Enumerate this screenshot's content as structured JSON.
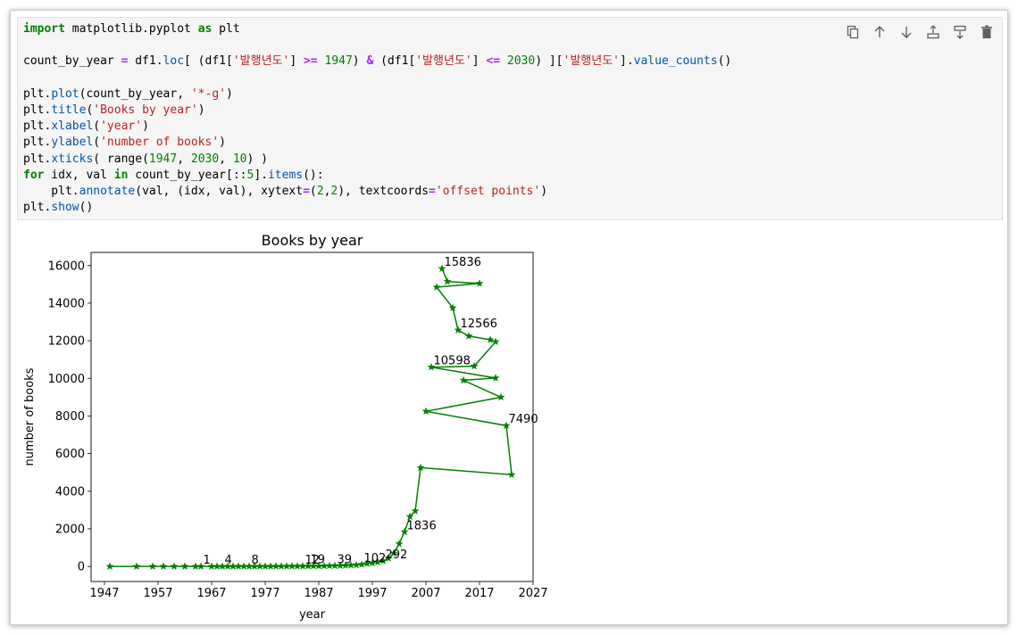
{
  "toolbar": {
    "buttons": [
      {
        "name": "copy-cell-button",
        "icon": "copy-icon"
      },
      {
        "name": "move-up-button",
        "icon": "arrow-up-icon"
      },
      {
        "name": "move-down-button",
        "icon": "arrow-down-icon"
      },
      {
        "name": "insert-above-button",
        "icon": "insert-above-icon"
      },
      {
        "name": "insert-below-button",
        "icon": "insert-below-icon"
      },
      {
        "name": "delete-cell-button",
        "icon": "trash-icon"
      }
    ]
  },
  "code": {
    "l1": {
      "import": "import",
      "module": " matplotlib.pyplot ",
      "as": "as",
      "alias": " plt"
    },
    "l3": {
      "a": "count_by_year ",
      "eq": "=",
      "b": " df1.",
      "loc": "loc",
      "c": "[ (df1[",
      "s1": "'발행년도'",
      "d": "] ",
      "ge": ">=",
      "e": " ",
      "n1": "1947",
      "f": ") ",
      "amp": "&",
      "g": " (df1[",
      "s2": "'발행년도'",
      "h": "] ",
      "le": "<=",
      "i": " ",
      "n2": "2030",
      "j": ") ][",
      "s3": "'발행년도'",
      "k": "].",
      "vc": "value_counts",
      "l": "()"
    },
    "l5": {
      "a": "plt.",
      "fn": "plot",
      "b": "(count_by_year, ",
      "s": "'*-g'",
      "c": ")"
    },
    "l6": {
      "a": "plt.",
      "fn": "title",
      "b": "(",
      "s": "'Books by year'",
      "c": ")"
    },
    "l7": {
      "a": "plt.",
      "fn": "xlabel",
      "b": "(",
      "s": "'year'",
      "c": ")"
    },
    "l8": {
      "a": "plt.",
      "fn": "ylabel",
      "b": "(",
      "s": "'number of books'",
      "c": ")"
    },
    "l9": {
      "a": "plt.",
      "fn": "xticks",
      "b": "( range(",
      "n1": "1947",
      "c": ", ",
      "n2": "2030",
      "d": ", ",
      "n3": "10",
      "e": ") )"
    },
    "l10": {
      "for": "for",
      "a": " idx, val ",
      "in": "in",
      "b": " count_by_year[::",
      "n": "5",
      "c": "].",
      "fn": "items",
      "d": "():"
    },
    "l11": {
      "a": "    plt.",
      "fn": "annotate",
      "b": "(val, (idx, val), xytext",
      "eq": "=",
      "c": "(",
      "n1": "2",
      "d": ",",
      "n2": "2",
      "e": "), textcoords",
      "eq2": "=",
      "s": "'offset points'",
      "f": ")"
    },
    "l12": {
      "a": "plt.",
      "fn": "show",
      "b": "()"
    }
  },
  "colors": {
    "line": "#008000",
    "keyword": "#008000",
    "operator": "#aa22ff",
    "function": "#0055aa",
    "string": "#ba2121"
  },
  "chart_data": {
    "type": "line",
    "title": "Books by year",
    "xlabel": "year",
    "ylabel": "number of books",
    "xlim": [
      1944.5,
      2027
    ],
    "ylim": [
      -800,
      16700
    ],
    "xticks": [
      1947,
      1957,
      1967,
      1977,
      1987,
      1997,
      2007,
      2017,
      2027
    ],
    "yticks": [
      0,
      2000,
      4000,
      6000,
      8000,
      10000,
      12000,
      14000,
      16000
    ],
    "marker": "*",
    "line_color": "#008000",
    "series": [
      {
        "x": [
          2010,
          2011,
          2017,
          2009,
          2012,
          2013,
          2015,
          2019,
          2020,
          2016,
          2008,
          2020,
          2014,
          2021,
          2007,
          2022,
          2023,
          2006,
          2005,
          2004,
          2003,
          2002,
          2001,
          2000,
          1999,
          1998,
          1997,
          1996,
          1995,
          1994,
          1993,
          1992,
          1991,
          1990,
          1989,
          1988,
          1987,
          1986,
          1985,
          1984,
          1983,
          1982,
          1981,
          1980,
          1979,
          1978,
          1977,
          1976,
          1975,
          1974,
          1973,
          1972,
          1971,
          1970,
          1969,
          1968,
          1967,
          1965,
          1964,
          1962,
          1960,
          1958,
          1956,
          1953,
          1948
        ],
        "y": [
          15836,
          15150,
          15050,
          14850,
          13750,
          12566,
          12250,
          12050,
          11950,
          10650,
          10598,
          10020,
          9900,
          9000,
          8250,
          7490,
          4880,
          5250,
          2950,
          2650,
          1836,
          1200,
          700,
          430,
          292,
          230,
          180,
          150,
          102,
          80,
          65,
          55,
          45,
          39,
          35,
          29,
          25,
          22,
          19,
          15,
          12,
          10,
          9,
          8,
          7,
          6,
          5,
          5,
          5,
          4,
          4,
          4,
          3,
          3,
          2,
          2,
          1,
          1,
          1,
          1,
          1,
          0,
          0,
          0,
          0
        ]
      }
    ],
    "annotations": [
      {
        "x": 2010,
        "y": 15836,
        "text": "15836"
      },
      {
        "x": 2013,
        "y": 12566,
        "text": "12566"
      },
      {
        "x": 2008,
        "y": 10598,
        "text": "10598"
      },
      {
        "x": 2022,
        "y": 7490,
        "text": "7490"
      },
      {
        "x": 2003,
        "y": 1836,
        "text": "1836"
      },
      {
        "x": 1999,
        "y": 292,
        "text": "292"
      },
      {
        "x": 1995,
        "y": 102,
        "text": "102"
      },
      {
        "x": 1990,
        "y": 39,
        "text": "39"
      },
      {
        "x": 1985,
        "y": 19,
        "text": "19"
      },
      {
        "x": 1984,
        "y": 12,
        "text": "12"
      },
      {
        "x": 1974,
        "y": 8,
        "text": "8"
      },
      {
        "x": 1969,
        "y": 4,
        "text": "4"
      },
      {
        "x": 1965,
        "y": 1,
        "text": "1"
      }
    ]
  }
}
